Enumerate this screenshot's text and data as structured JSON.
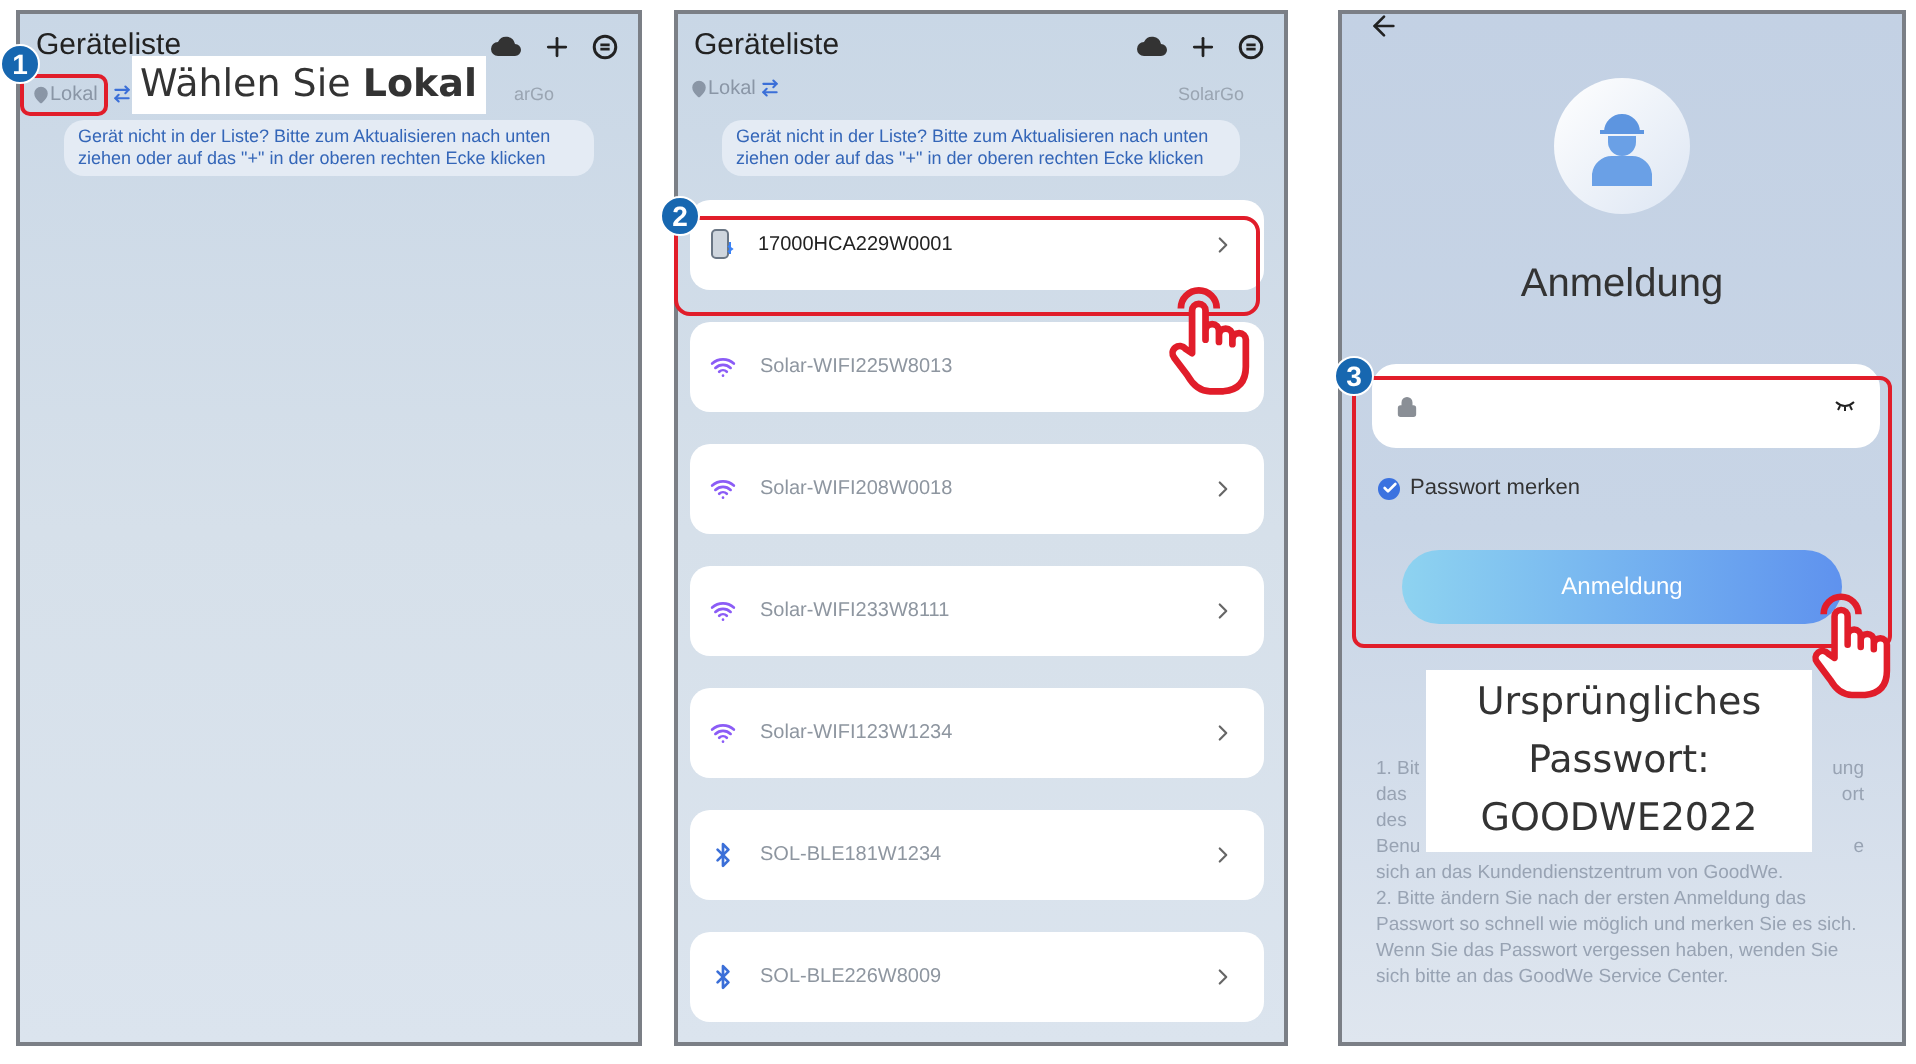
{
  "panels": [
    {
      "kind": "device_list",
      "title": "Geräteliste",
      "location": {
        "label": "Lokal",
        "highlighted": true
      },
      "version": "arGo",
      "hint": "Gerät nicht in der Liste? Bitte zum Aktualisieren nach unten ziehen oder auf das \"+\" in der oberen rechten Ecke klicken",
      "step": "1",
      "callout": "Wählen Sie **Lokal**"
    },
    {
      "kind": "device_list",
      "title": "Geräteliste",
      "location": {
        "label": "Lokal"
      },
      "version": "SolarGo",
      "hint": "Gerät nicht in der Liste? Bitte zum Aktualisieren nach unten ziehen oder auf das \"+\" in der oberen rechten Ecke klicken",
      "step": "2",
      "pointer": true,
      "devices": [
        {
          "name": "17000HCA229W0001",
          "kind": "inverter",
          "highlighted": true
        },
        {
          "name": "Solar-WIFI225W8013",
          "kind": "wifi",
          "highlighted": false
        },
        {
          "name": "Solar-WIFI208W0018",
          "kind": "wifi",
          "highlighted": false
        },
        {
          "name": "Solar-WIFI233W8111",
          "kind": "wifi",
          "highlighted": false
        },
        {
          "name": "Solar-WIFI123W1234",
          "kind": "wifi",
          "highlighted": false
        },
        {
          "name": "SOL-BLE181W1234",
          "kind": "bluetooth",
          "highlighted": false
        },
        {
          "name": "SOL-BLE226W8009",
          "kind": "bluetooth",
          "highlighted": false
        }
      ]
    },
    {
      "kind": "login",
      "title": "Anmeldung",
      "step": "3",
      "pointer": true,
      "form_highlighted": true,
      "remember": {
        "label": "Passwort merken",
        "checked": true
      },
      "button": "Anmeldung",
      "callout": "Ursprüngliches Passwort: GOODWE2022",
      "note_fragments": [
        {
          "left": "1. Bit",
          "right": "ung"
        },
        {
          "left": "das",
          "right": "ort"
        },
        {
          "left": "des"
        },
        {
          "left": "Benu",
          "right": "e"
        }
      ],
      "note_1_end": "sich an das Kundendienstzentrum von GoodWe.",
      "note_2": "2. Bitte ändern Sie nach der ersten Anmeldung das Passwort so schnell wie möglich und merken Sie es sich. Wenn Sie das Passwort vergessen haben, wenden Sie sich bitte an das GoodWe Service Center."
    }
  ]
}
